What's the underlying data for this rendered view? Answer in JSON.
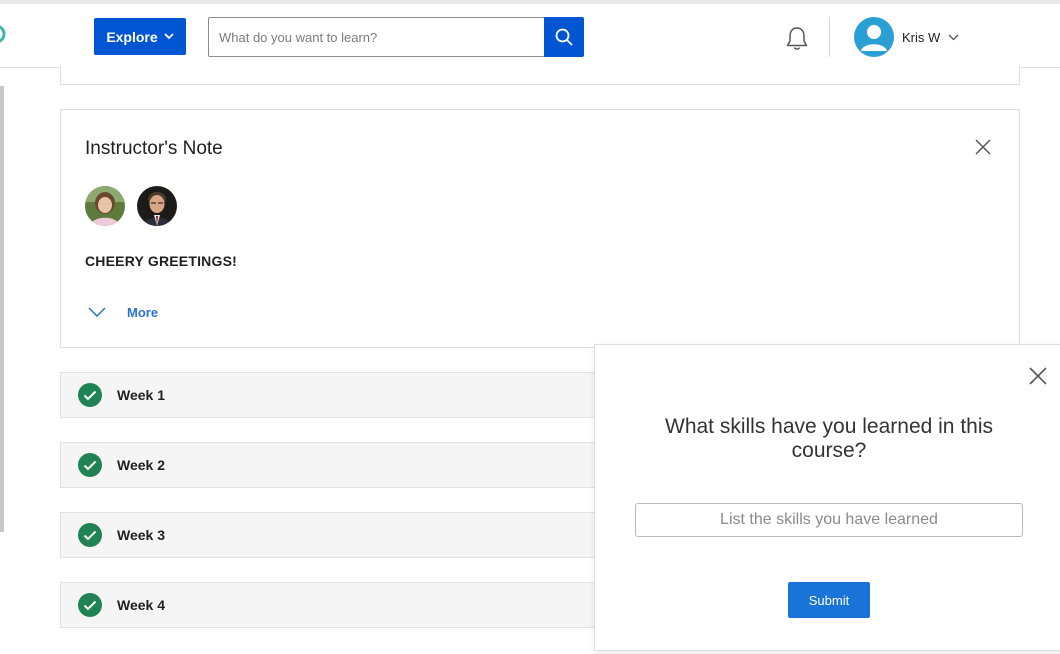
{
  "header": {
    "explore_label": "Explore",
    "search_placeholder": "What do you want to learn?",
    "user_name": "Kris W",
    "brand_color": "#0056d2"
  },
  "instructor_note": {
    "title": "Instructor's Note",
    "greeting": "CHEERY GREETINGS!",
    "more_label": "More"
  },
  "weeks": [
    {
      "label": "Week 1",
      "status": "completed"
    },
    {
      "label": "Week 2",
      "status": "completed"
    },
    {
      "label": "Week 3",
      "status": "completed"
    },
    {
      "label": "Week 4",
      "status": "completed"
    }
  ],
  "skills_popup": {
    "question": "What skills have you learned in this course?",
    "input_placeholder": "List the skills you have learned",
    "submit_label": "Submit"
  },
  "colors": {
    "check_green": "#1f8354",
    "link_blue": "#2a73cc",
    "submit_blue": "#1a73d6"
  }
}
